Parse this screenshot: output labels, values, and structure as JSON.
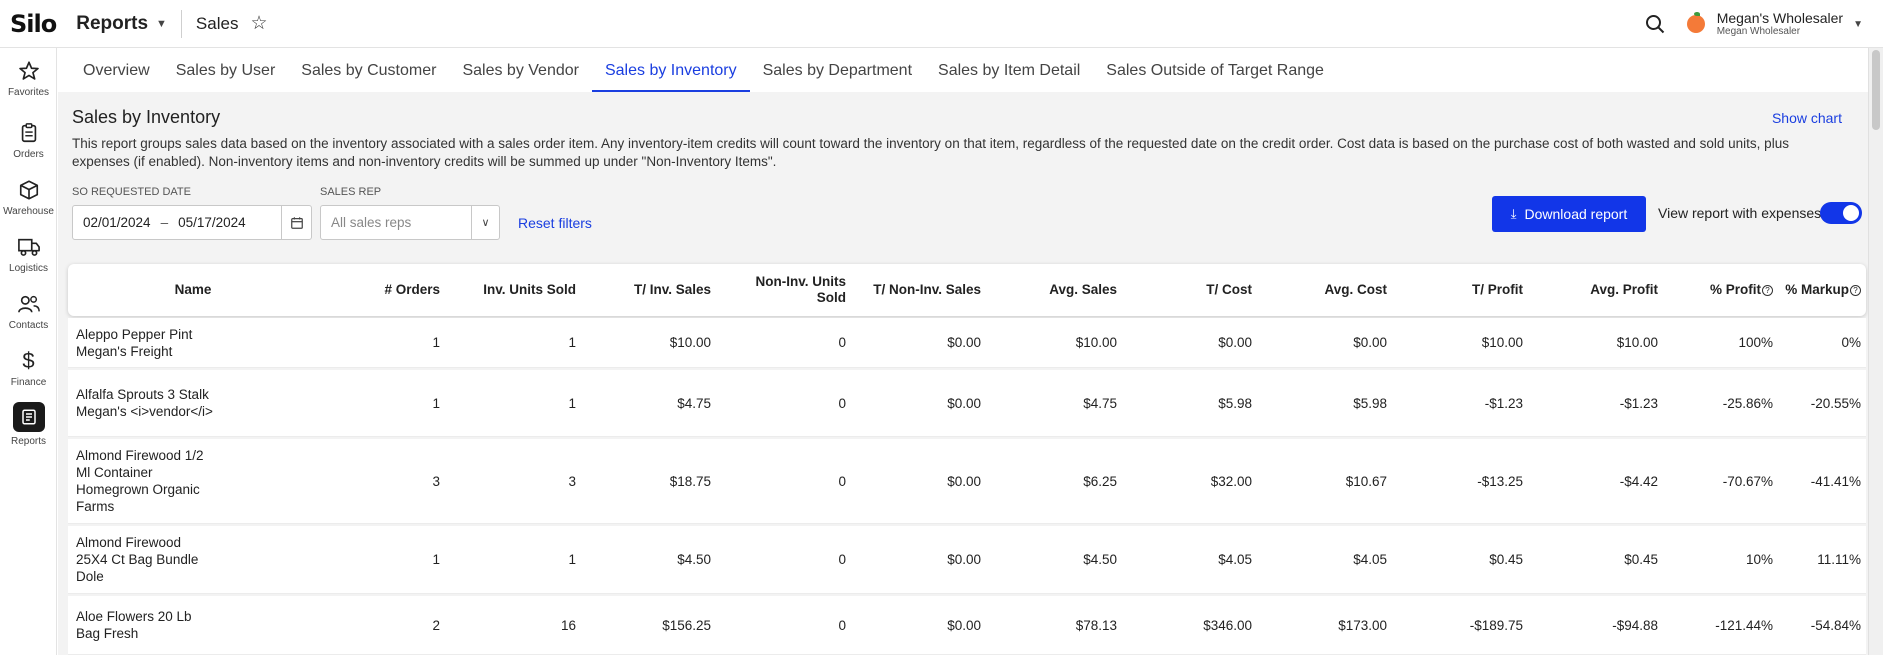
{
  "app": {
    "logo": "Silo"
  },
  "topbar": {
    "module": "Reports",
    "page": "Sales",
    "account_name": "Megan's Wholesaler",
    "account_sub": "Megan Wholesaler"
  },
  "sidebar": {
    "items": [
      {
        "label": "Favorites",
        "icon": "star-icon"
      },
      {
        "label": "Orders",
        "icon": "clipboard-icon"
      },
      {
        "label": "Warehouse",
        "icon": "box-icon"
      },
      {
        "label": "Logistics",
        "icon": "truck-icon"
      },
      {
        "label": "Contacts",
        "icon": "people-icon"
      },
      {
        "label": "Finance",
        "icon": "dollar-icon"
      },
      {
        "label": "Reports",
        "icon": "report-icon"
      }
    ]
  },
  "tabs": [
    {
      "label": "Overview"
    },
    {
      "label": "Sales by User"
    },
    {
      "label": "Sales by Customer"
    },
    {
      "label": "Sales by Vendor"
    },
    {
      "label": "Sales by Inventory"
    },
    {
      "label": "Sales by Department"
    },
    {
      "label": "Sales by Item Detail"
    },
    {
      "label": "Sales Outside of Target Range"
    }
  ],
  "active_tab": "Sales by Inventory",
  "report": {
    "title": "Sales by Inventory",
    "show_chart": "Show chart",
    "description": "This report groups sales data based on the inventory associated with a sales order item. Any inventory-item credits will count toward the inventory on that item, regardless of the requested date on the credit order. Cost data is based on the purchase cost of both wasted and sold units, plus expenses (if enabled). Non-inventory items and non-inventory credits will be summed up under \"Non-Inventory Items\"."
  },
  "filters": {
    "date_label": "SO REQUESTED DATE",
    "date_from": "02/01/2024",
    "date_sep": "–",
    "date_to": "05/17/2024",
    "rep_label": "SALES REP",
    "rep_placeholder": "All sales reps",
    "reset": "Reset filters"
  },
  "actions": {
    "download": "Download report",
    "expenses_label": "View report with expenses",
    "expenses_on": true
  },
  "table": {
    "headers": {
      "name": "Name",
      "orders": "# Orders",
      "inv_units": "Inv. Units Sold",
      "inv_sales": "T/ Inv. Sales",
      "noninv_units": "Non-Inv. Units Sold",
      "noninv_sales": "T/ Non-Inv. Sales",
      "avg_sales": "Avg. Sales",
      "cost": "T/ Cost",
      "avg_cost": "Avg. Cost",
      "profit": "T/ Profit",
      "avg_profit": "Avg. Profit",
      "pct_profit": "% Profit",
      "pct_markup": "% Markup"
    },
    "rows": [
      {
        "name": "Aleppo Pepper Pint Megan's Freight",
        "orders": "1",
        "inv_units": "1",
        "inv_sales": "$10.00",
        "noninv_units": "0",
        "noninv_sales": "$0.00",
        "avg_sales": "$10.00",
        "cost": "$0.00",
        "avg_cost": "$0.00",
        "profit": "$10.00",
        "avg_profit": "$10.00",
        "pct_profit": "100%",
        "pct_markup": "0%"
      },
      {
        "name": "Alfalfa Sprouts 3 Stalk Megan's <i>vendor</i>",
        "orders": "1",
        "inv_units": "1",
        "inv_sales": "$4.75",
        "noninv_units": "0",
        "noninv_sales": "$0.00",
        "avg_sales": "$4.75",
        "cost": "$5.98",
        "avg_cost": "$5.98",
        "profit": "-$1.23",
        "avg_profit": "-$1.23",
        "pct_profit": "-25.86%",
        "pct_markup": "-20.55%"
      },
      {
        "name": "Almond Firewood 1/2 Ml Container Homegrown Organic Farms",
        "orders": "3",
        "inv_units": "3",
        "inv_sales": "$18.75",
        "noninv_units": "0",
        "noninv_sales": "$0.00",
        "avg_sales": "$6.25",
        "cost": "$32.00",
        "avg_cost": "$10.67",
        "profit": "-$13.25",
        "avg_profit": "-$4.42",
        "pct_profit": "-70.67%",
        "pct_markup": "-41.41%"
      },
      {
        "name": "Almond Firewood 25X4 Ct Bag Bundle Dole",
        "orders": "1",
        "inv_units": "1",
        "inv_sales": "$4.50",
        "noninv_units": "0",
        "noninv_sales": "$0.00",
        "avg_sales": "$4.50",
        "cost": "$4.05",
        "avg_cost": "$4.05",
        "profit": "$0.45",
        "avg_profit": "$0.45",
        "pct_profit": "10%",
        "pct_markup": "11.11%"
      },
      {
        "name": "Aloe Flowers 20 Lb Bag Fresh",
        "orders": "2",
        "inv_units": "16",
        "inv_sales": "$156.25",
        "noninv_units": "0",
        "noninv_sales": "$0.00",
        "avg_sales": "$78.13",
        "cost": "$346.00",
        "avg_cost": "$173.00",
        "profit": "-$189.75",
        "avg_profit": "-$94.88",
        "pct_profit": "-121.44%",
        "pct_markup": "-54.84%"
      }
    ]
  },
  "colors": {
    "accent": "#1236e8",
    "link": "#1a3ee0",
    "page_bg": "#f3f3f3"
  }
}
